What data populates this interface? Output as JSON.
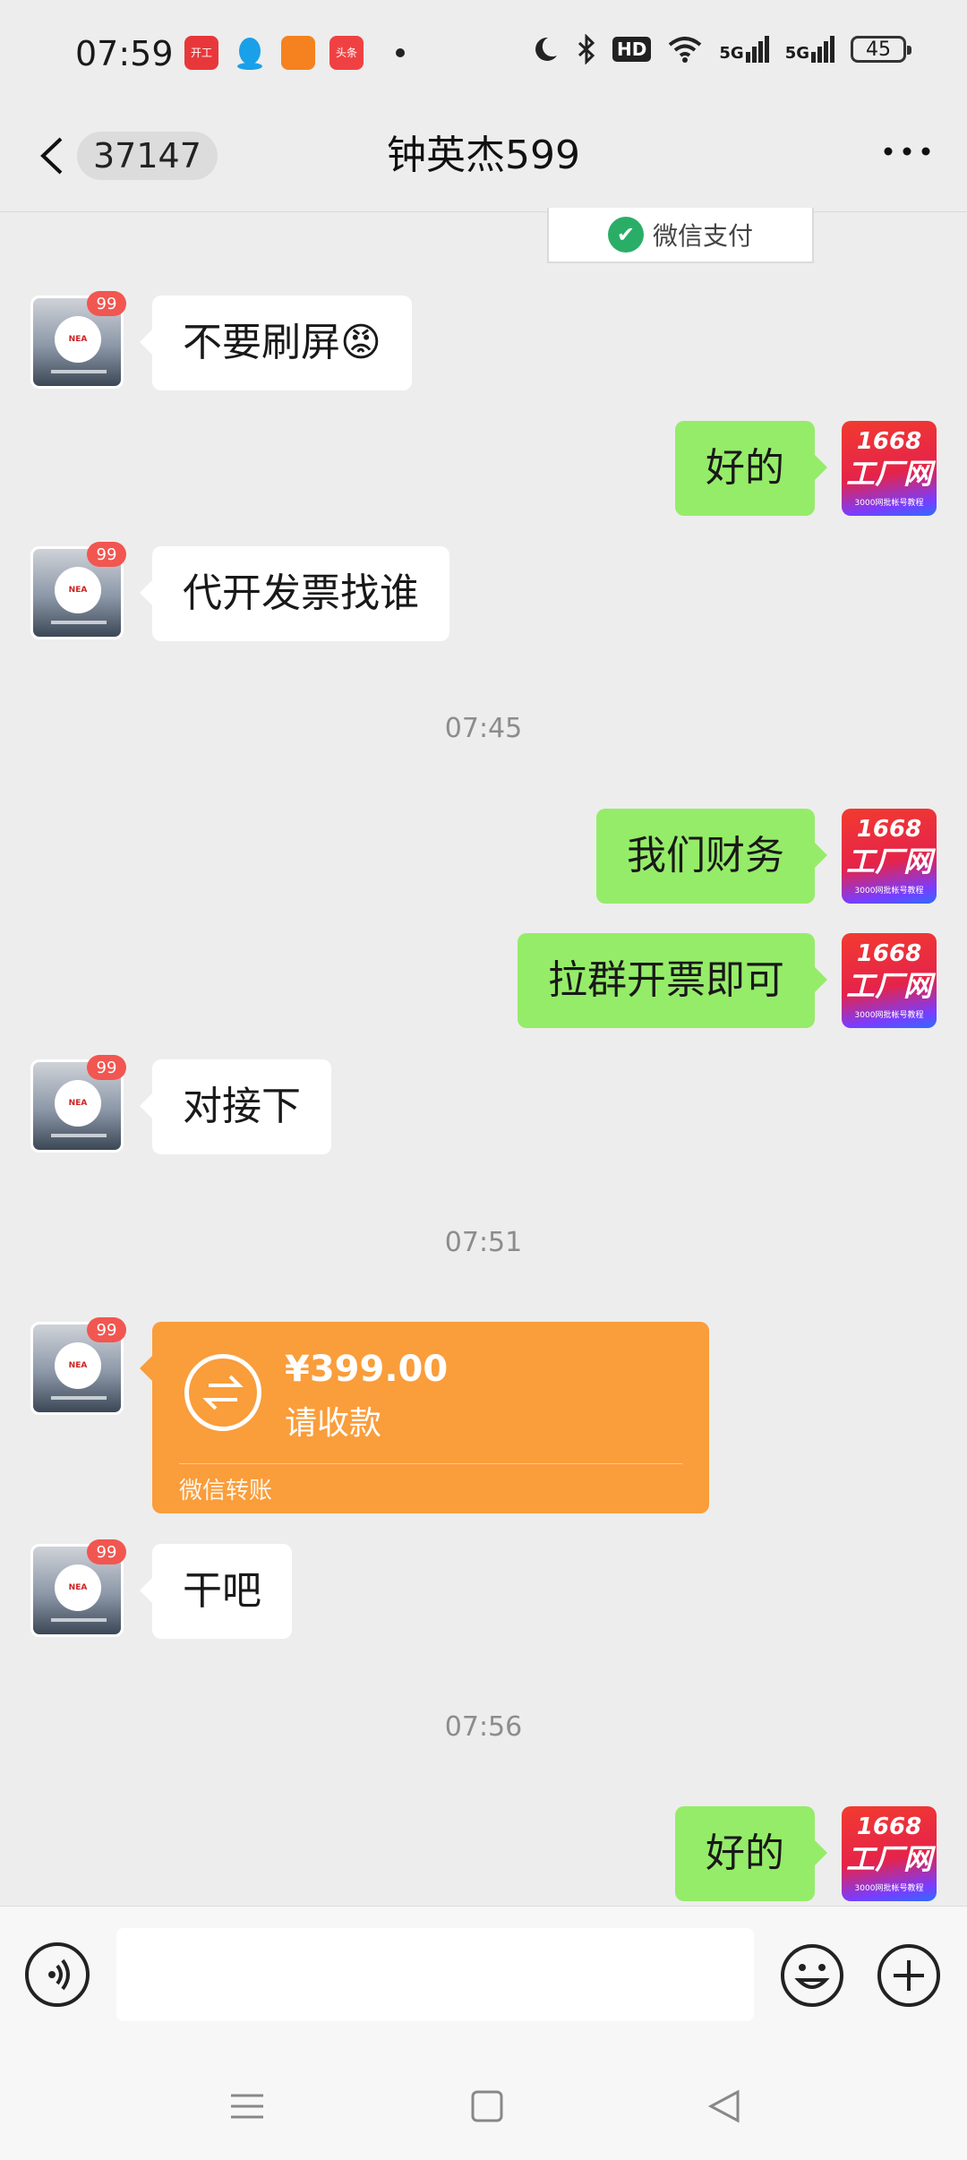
{
  "status_bar": {
    "time": "07:59",
    "notification_apps": [
      {
        "name": "app-icon",
        "label": "开工"
      },
      {
        "name": "qq-icon",
        "label": ""
      },
      {
        "name": "app-icon",
        "label": ""
      },
      {
        "name": "toutiao-icon",
        "label": "头条"
      }
    ],
    "hd_label": "HD",
    "network_1": "5G",
    "network_2": "5G",
    "battery": "45"
  },
  "header": {
    "unread_count": "37147",
    "title": "钟英杰599"
  },
  "messages": [
    {
      "type": "card-fragment",
      "text": "微信支付"
    },
    {
      "side": "left",
      "text": "不要刷屏😡"
    },
    {
      "side": "right",
      "text": "好的"
    },
    {
      "side": "left",
      "text": "代开发票找谁"
    },
    {
      "type": "time",
      "text": "07:45"
    },
    {
      "side": "right",
      "text": "我们财务"
    },
    {
      "side": "right",
      "text": "拉群开票即可"
    },
    {
      "side": "left",
      "text": "对接下"
    },
    {
      "type": "time",
      "text": "07:51"
    },
    {
      "side": "left",
      "type": "transfer",
      "amount": "¥399.00",
      "note": "请收款",
      "footer": "微信转账"
    },
    {
      "side": "left",
      "text": "干吧"
    },
    {
      "type": "time",
      "text": "07:56"
    },
    {
      "side": "right",
      "text": "好的"
    }
  ],
  "contact_avatar": {
    "badge": "99"
  },
  "my_avatar": {
    "line1": "1668",
    "line2": "工厂网",
    "line3": "3000网批帐号教程"
  },
  "input": {
    "value": "",
    "placeholder": ""
  },
  "colors": {
    "bubble_right": "#95ec69",
    "transfer": "#fa9d3b",
    "background": "#ededed"
  }
}
